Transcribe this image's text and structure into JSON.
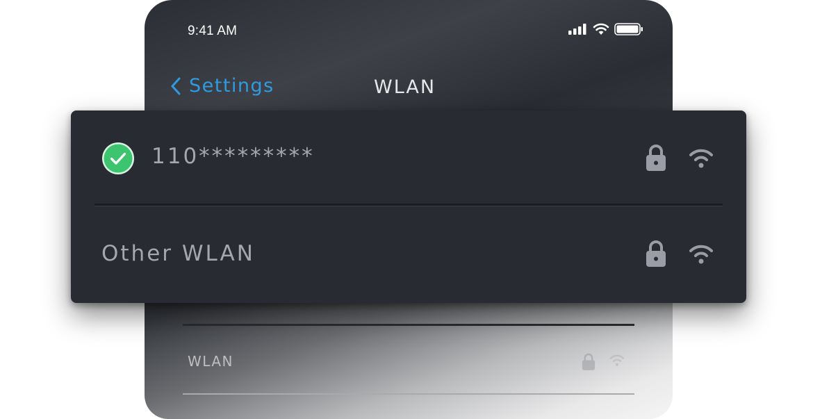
{
  "status_bar": {
    "time": "9:41 AM",
    "icons": [
      "cellular-signal-icon",
      "wifi-icon",
      "battery-icon"
    ]
  },
  "nav": {
    "back_label": "Settings",
    "back_icon": "chevron-left-icon",
    "title": "WLAN"
  },
  "networks": [
    {
      "name": "110*********",
      "connected": true,
      "secured": true,
      "icons": [
        "checkmark-icon",
        "lock-icon",
        "wifi-icon"
      ]
    }
  ],
  "other_network": {
    "label": "Other WLAN",
    "icons": [
      "lock-icon",
      "wifi-icon"
    ]
  },
  "background_row": {
    "label": "WLAN"
  },
  "colors": {
    "accent": "#2f9be2",
    "check_green": "#3cc46f",
    "card_bg": "#292b33",
    "text_muted": "#a4a7b0",
    "icon_gray": "#9a9da6"
  }
}
